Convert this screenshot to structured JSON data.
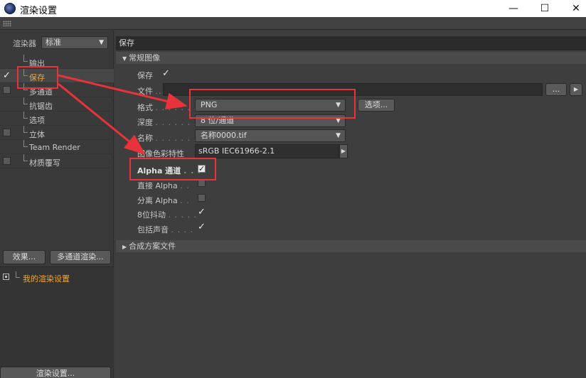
{
  "window": {
    "title": "渲染设置",
    "minimize": "—",
    "maximize": "☐",
    "close": "✕"
  },
  "left": {
    "renderer_label": "渲染器",
    "renderer_value": "标准",
    "tree": [
      {
        "label": "输出",
        "check": "none"
      },
      {
        "label": "保存",
        "check": "checked",
        "selected": true
      },
      {
        "label": "多通道",
        "check": "off"
      },
      {
        "label": "抗锯齿",
        "check": "none"
      },
      {
        "label": "选项",
        "check": "none"
      },
      {
        "label": "立体",
        "check": "off"
      },
      {
        "label": "Team Render",
        "check": "none"
      },
      {
        "label": "材质覆写",
        "check": "off"
      }
    ],
    "effect_button": "效果...",
    "multipass_button": "多通道渲染...",
    "preset_label": "我的渲染设置",
    "render_settings_button": "渲染设置..."
  },
  "right": {
    "section_title": "保存",
    "group_general": "常规图像",
    "group_composite": "合成方案文件",
    "save_label": "保存",
    "file_label": "文件",
    "file_button": "...",
    "format_label": "格式",
    "format_value": "PNG",
    "options_button": "选项...",
    "depth_label": "深度",
    "depth_value": "8 位/通道",
    "name_label": "名称",
    "name_value": "名称0000.tif",
    "profile_label": "图像色彩特性",
    "profile_value": "sRGB IEC61966-2.1",
    "alpha_label": "Alpha 通道",
    "straight_alpha_label": "直接 Alpha",
    "separate_alpha_label": "分离 Alpha",
    "dither_label": "8位抖动",
    "sound_label": "包括声音",
    "dots": ". . . . . . .",
    "check_mark": "✓"
  }
}
